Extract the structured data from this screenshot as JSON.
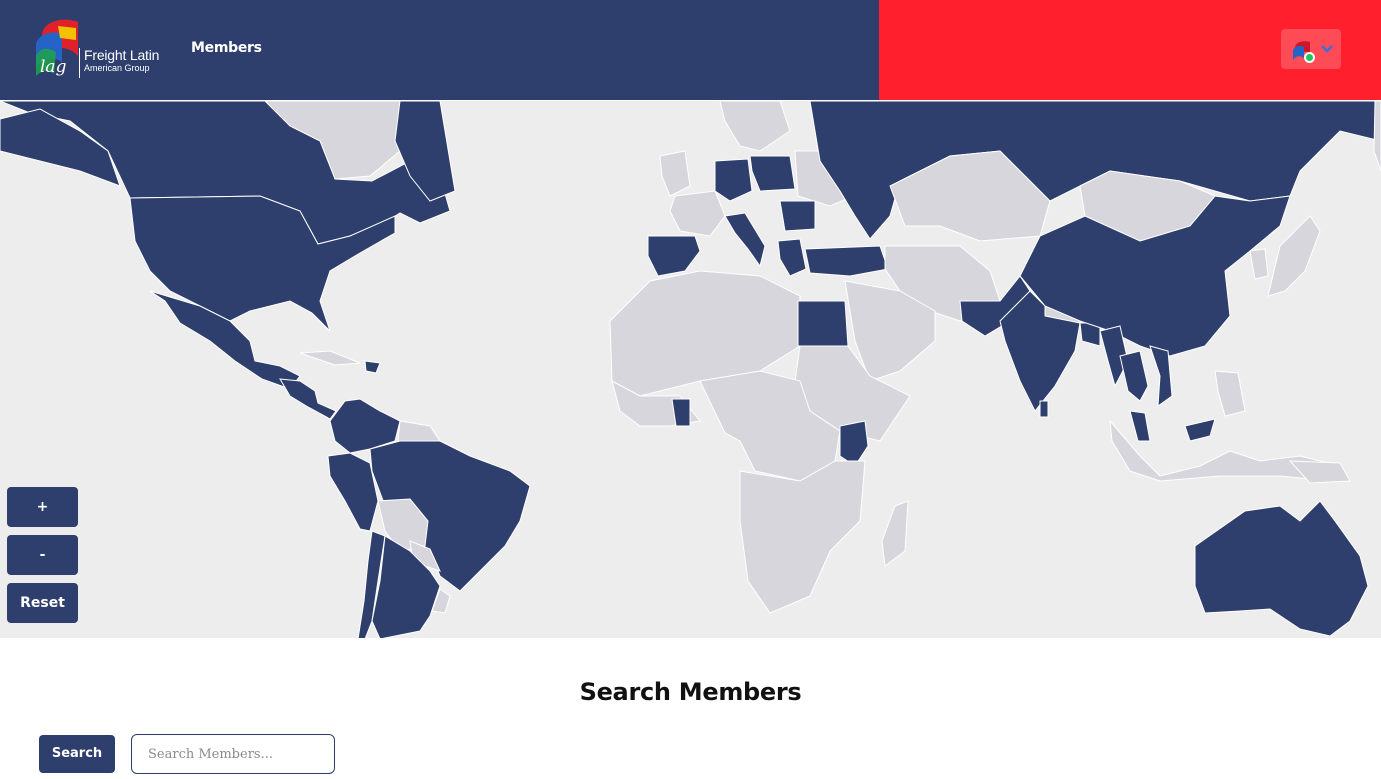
{
  "header": {
    "logo": {
      "line1": "Freight Latin",
      "line2": "American Group",
      "mark_text": "lag"
    },
    "nav": {
      "members_label": "Members"
    },
    "colors": {
      "primary": "#2e3f6e",
      "accent": "#ff1f2d"
    },
    "user_menu": {
      "avatar_icon": "flag-avatar-icon",
      "status": "online",
      "dropdown_icon": "chevron-down-icon"
    }
  },
  "map": {
    "zoom_in_label": "+",
    "zoom_out_label": "-",
    "reset_label": "Reset",
    "member_color": "#2e3f6e",
    "non_member_color": "#d6d6dc",
    "highlighted_regions": [
      "United States",
      "Canada",
      "Mexico",
      "Central America",
      "Colombia",
      "Venezuela",
      "Ecuador",
      "Peru",
      "Brazil",
      "Chile",
      "Argentina",
      "Uruguay",
      "Spain",
      "Italy",
      "Germany",
      "Poland",
      "Romania",
      "Greece",
      "Turkey",
      "Russia",
      "Egypt",
      "Ghana",
      "Cameroon",
      "Kenya",
      "China",
      "Pakistan",
      "India",
      "Sri Lanka",
      "Bangladesh",
      "Myanmar",
      "Thailand",
      "Vietnam",
      "Malaysia",
      "Australia"
    ]
  },
  "search": {
    "title": "Search Members",
    "button_label": "Search",
    "placeholder": "Search Members..."
  }
}
